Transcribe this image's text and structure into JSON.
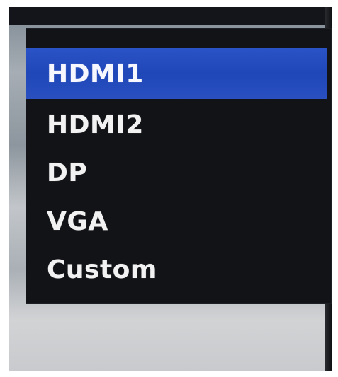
{
  "input_menu": {
    "selected_index": 0,
    "items": [
      {
        "label": "HDMI1",
        "selected": true
      },
      {
        "label": "HDMI2",
        "selected": false
      },
      {
        "label": "DP",
        "selected": false
      },
      {
        "label": "VGA",
        "selected": false
      },
      {
        "label": "Custom",
        "selected": false
      }
    ]
  },
  "colors": {
    "panel_background": "#121317",
    "selection_highlight": "#2448bd",
    "item_text": "#f2f2f2"
  }
}
